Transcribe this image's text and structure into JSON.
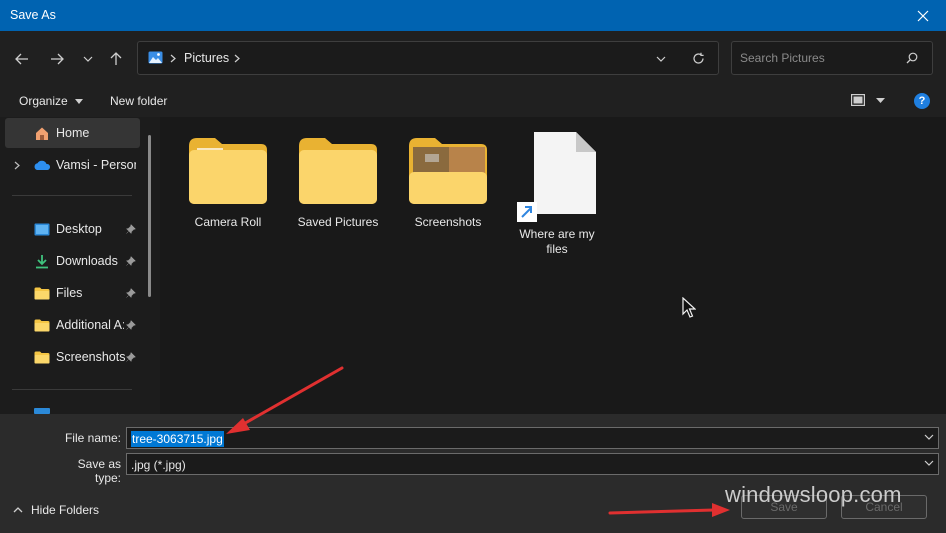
{
  "window": {
    "title": "Save As"
  },
  "address": {
    "path": [
      "Pictures"
    ]
  },
  "search": {
    "placeholder": "Search Pictures"
  },
  "toolbar": {
    "organize_label": "Organize",
    "new_folder_label": "New folder"
  },
  "sidebar": {
    "items": [
      {
        "label": "Home"
      },
      {
        "label": "Vamsi - Persona"
      },
      {
        "label": "Desktop"
      },
      {
        "label": "Downloads"
      },
      {
        "label": "Files"
      },
      {
        "label": "Additional A:"
      },
      {
        "label": "Screenshots"
      }
    ]
  },
  "content": {
    "items": [
      {
        "label": "Camera Roll",
        "icon": "folder-icon"
      },
      {
        "label": "Saved Pictures",
        "icon": "folder-icon"
      },
      {
        "label": "Screenshots",
        "icon": "folder-icon"
      },
      {
        "label": "Where are my files",
        "icon": "shortcut-file-icon"
      }
    ]
  },
  "form": {
    "file_name_label": "File name:",
    "file_name_value": "tree-3063715.jpg",
    "save_as_type_label": "Save as type:",
    "save_as_type_value": ".jpg (*.jpg)"
  },
  "footer": {
    "hide_folders_label": "Hide Folders",
    "save_label": "Save",
    "cancel_label": "Cancel"
  },
  "watermark": "windowsloop.com",
  "colors": {
    "titlebar": "#0063b1",
    "selection": "#0078d4",
    "annotation_arrow": "#e03030"
  }
}
